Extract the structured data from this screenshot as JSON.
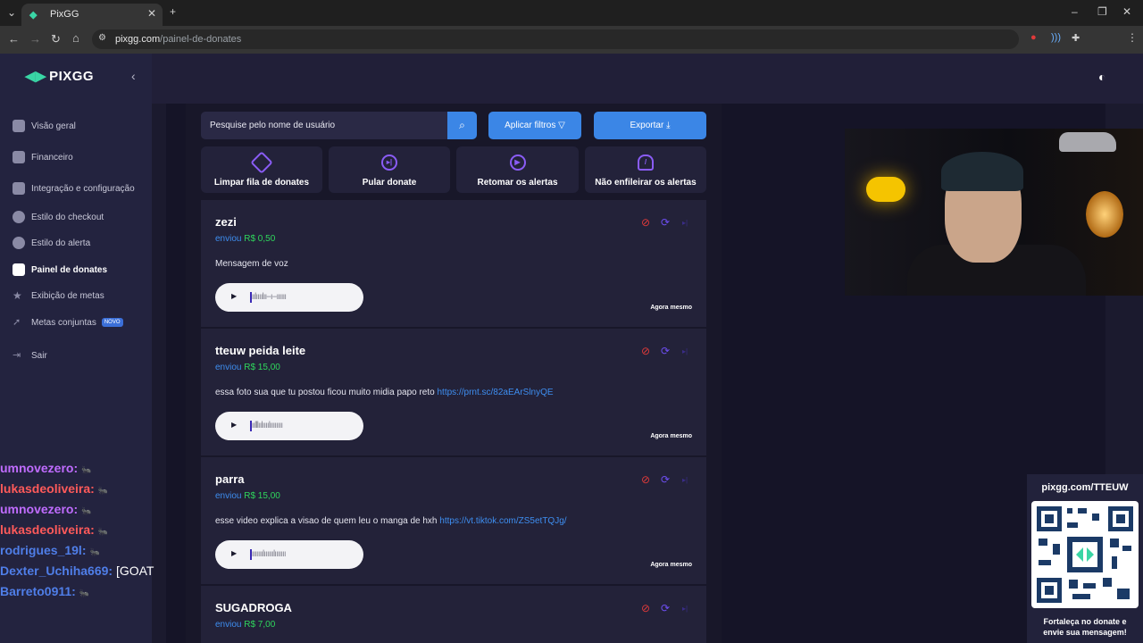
{
  "browser": {
    "tab_title": "PixGG",
    "url_host": "pixgg.com",
    "url_path": "/painel-de-donates",
    "profile_initial": "M"
  },
  "sidebar": {
    "logo": "PIXGG",
    "items": [
      {
        "label": "Visão geral",
        "icon": "home-icon"
      },
      {
        "label": "Financeiro",
        "icon": "wallet-icon"
      },
      {
        "label": "Integração e configuração",
        "icon": "settings-icon"
      },
      {
        "label": "Estilo do checkout",
        "icon": "palette-icon"
      },
      {
        "label": "Estilo do alerta",
        "icon": "alert-style-icon"
      },
      {
        "label": "Painel de donates",
        "icon": "donate-hand-icon"
      },
      {
        "label": "Exibição de metas",
        "icon": "star-icon"
      },
      {
        "label": "Metas conjuntas",
        "icon": "rocket-icon",
        "badge": "NOVO"
      },
      {
        "label": "Sair",
        "icon": "logout-icon"
      }
    ]
  },
  "toolbar": {
    "search_placeholder": "Pesquise pelo nome de usuário",
    "filter_label": "Aplicar filtros",
    "export_label": "Exportar"
  },
  "actions": [
    {
      "label": "Limpar fila de donates",
      "icon": "eraser-icon"
    },
    {
      "label": "Pular donate",
      "icon": "skip-icon"
    },
    {
      "label": "Retomar os alertas",
      "icon": "play-icon"
    },
    {
      "label": "Não enfileirar os alertas",
      "icon": "bell-off-icon"
    }
  ],
  "donates": [
    {
      "name": "zezi",
      "sent_label": "enviou",
      "amount": "R$ 0,50",
      "message": "Mensagem de voz",
      "link": "",
      "time": "Agora mesmo",
      "wave": "|ıılıııılıı--ı--ıııııı"
    },
    {
      "name": "tteuw peida leite",
      "sent_label": "enviou",
      "amount": "R$ 15,00",
      "message": "essa foto sua que tu postou ficou muito midia papo reto",
      "link": "https://prnt.sc/82aEArSlnyQE",
      "time": "Agora mesmo",
      "wave": "|ıılllıılıııılıııııııı"
    },
    {
      "name": "parra",
      "sent_label": "enviou",
      "amount": "R$ 15,00",
      "message": "esse video explica a visao de quem leu o manga de hxh",
      "link": "https://vt.tiktok.com/ZS5etTQJg/",
      "time": "Agora mesmo",
      "wave": "|ııııııılıııııılııııııı"
    },
    {
      "name": "SUGADROGA",
      "sent_label": "enviou",
      "amount": "R$ 7,00",
      "message": "",
      "link": "",
      "time": "",
      "wave": ""
    }
  ],
  "chat": [
    {
      "user": "umnovezero:",
      "color": "#c06cff",
      "text": ""
    },
    {
      "user": "lukasdeoliveira:",
      "color": "#ff5a5a",
      "text": ""
    },
    {
      "user": "umnovezero:",
      "color": "#c06cff",
      "text": ""
    },
    {
      "user": "lukasdeoliveira:",
      "color": "#ff5a5a",
      "text": ""
    },
    {
      "user": "rodrigues_19l:",
      "color": "#4f7ee8",
      "text": ""
    },
    {
      "user": "Dexter_Uchiha669:",
      "color": "#4f7ee8",
      "text": "[GOAT"
    },
    {
      "user": "Barreto0911:",
      "color": "#4f7ee8",
      "text": ""
    }
  ],
  "qr_overlay": {
    "url": "pixgg.com/TTEUW",
    "caption_line1": "Fortaleça no donate e",
    "caption_line2": "envie sua mensagem!"
  }
}
